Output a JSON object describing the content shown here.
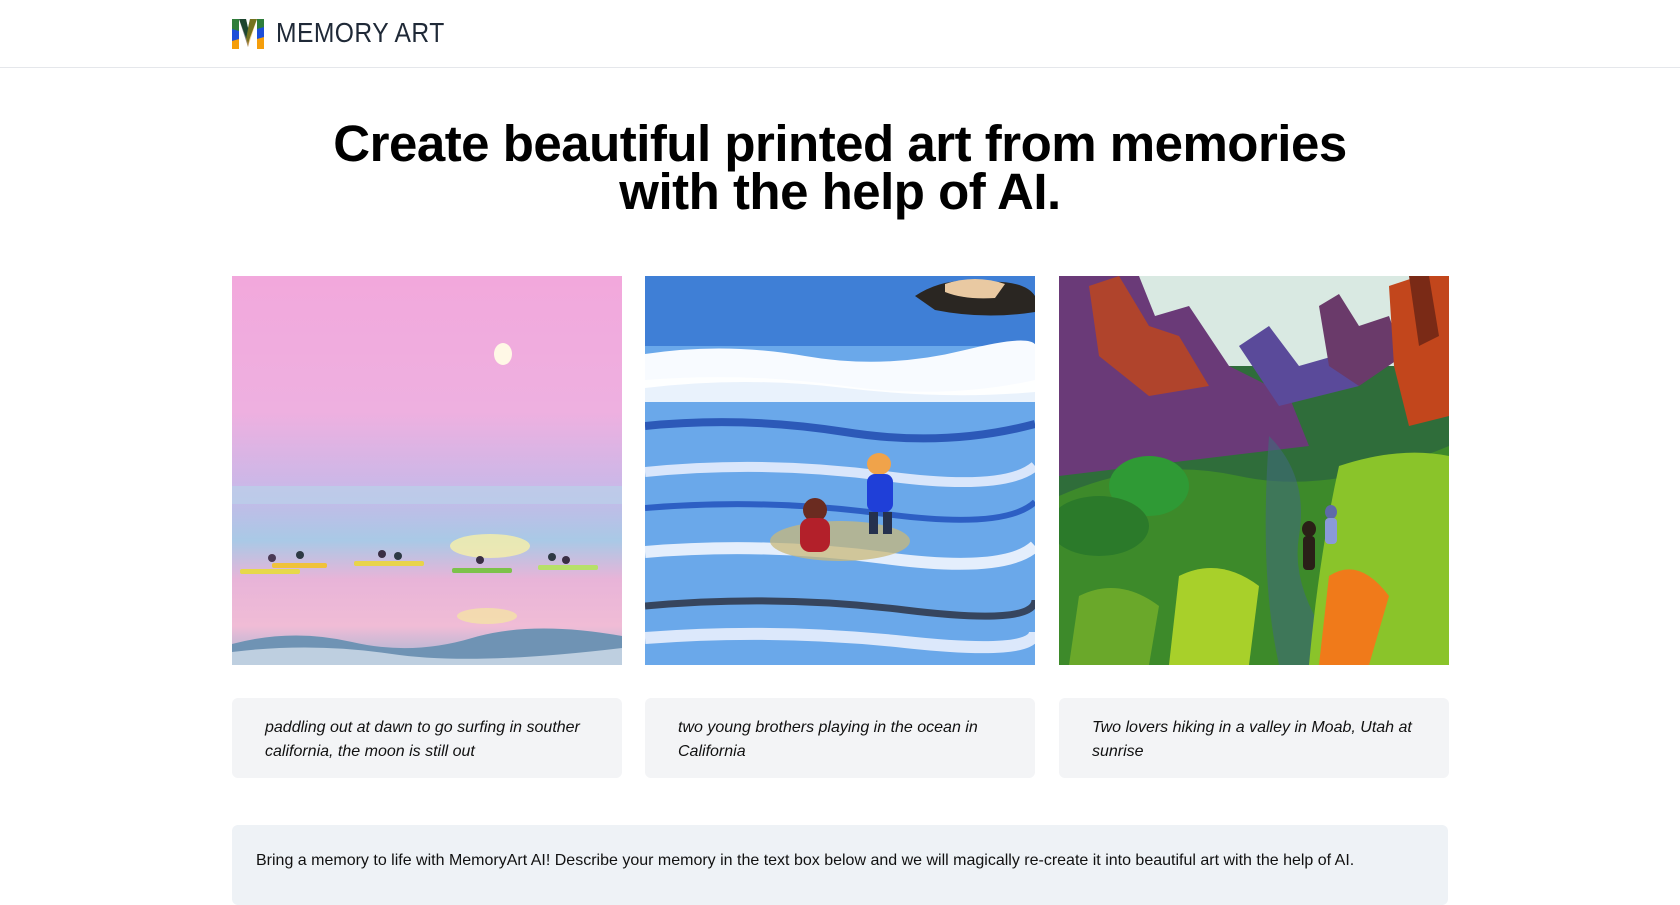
{
  "header": {
    "brand_name": "MEMORY ART",
    "logo_icon": "m-letter-logo-icon",
    "brand_colors": [
      "#2f7d3a",
      "#1d4ed8",
      "#f59e0b",
      "#111827"
    ]
  },
  "hero": {
    "title_line1": "Create beautiful printed art from memories",
    "title_line2": "with the help of AI."
  },
  "gallery": {
    "items": [
      {
        "caption": "paddling out at dawn to go surfing in souther california, the moon is still out",
        "art": "surfers-at-dawn-painting"
      },
      {
        "caption": "two young brothers playing in the ocean in California",
        "art": "brothers-in-ocean-painting"
      },
      {
        "caption": "Two lovers hiking in a valley in Moab, Utah at sunrise",
        "art": "moab-valley-hike-painting"
      }
    ]
  },
  "intro": {
    "text": "Bring a memory to life with MemoryArt AI! Describe your memory in the text box below and we will magically re-create it into beautiful art with the help of AI."
  }
}
